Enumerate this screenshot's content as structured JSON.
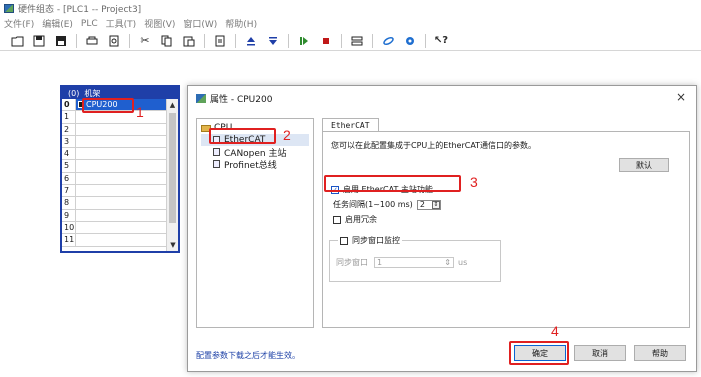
{
  "window": {
    "title": "硬件组态 - [PLC1 -- Project3]"
  },
  "menu": [
    "文件(F)",
    "编辑(E)",
    "PLC",
    "工具(T)",
    "视图(V)",
    "窗口(W)",
    "帮助(H)"
  ],
  "toolbar": {
    "icons": [
      "new-file-icon",
      "save-icon",
      "save-all-icon",
      "print-icon",
      "print-preview-icon",
      "cut-icon",
      "copy-icon",
      "paste-icon",
      "properties-icon",
      "upload-icon",
      "download-icon",
      "run-icon",
      "stop-icon",
      "diagnostics-icon",
      "link-icon",
      "network-icon",
      "help-icon"
    ]
  },
  "rack": {
    "header_slot": "(0)",
    "header_title": "机架",
    "rows": [
      {
        "slot": "0",
        "module": "CPU200"
      },
      {
        "slot": "1",
        "module": ""
      },
      {
        "slot": "2",
        "module": ""
      },
      {
        "slot": "3",
        "module": ""
      },
      {
        "slot": "4",
        "module": ""
      },
      {
        "slot": "5",
        "module": ""
      },
      {
        "slot": "6",
        "module": ""
      },
      {
        "slot": "7",
        "module": ""
      },
      {
        "slot": "8",
        "module": ""
      },
      {
        "slot": "9",
        "module": ""
      },
      {
        "slot": "10",
        "module": ""
      },
      {
        "slot": "11",
        "module": ""
      }
    ]
  },
  "dialog": {
    "title": "属性 - CPU200",
    "close": "×",
    "tree": {
      "root": "CPU",
      "children": [
        "EtherCAT",
        "CANopen 主站",
        "Profinet总线"
      ]
    },
    "tab_label": "EtherCAT",
    "description": "您可以在此配置集成于CPU上的EtherCAT通信口的参数。",
    "default_button": "默认",
    "enable_master_label": "启用 EtherCAT 主站功能",
    "enable_master_checked": true,
    "task_interval_label": "任务间隔(1~100 ms)",
    "task_interval_value": "2",
    "redundancy_label": "启用冗余",
    "redundancy_checked": false,
    "sync_group_label": "同步窗口监控",
    "sync_window_label": "同步窗口",
    "sync_window_value": "1",
    "sync_window_unit": "us",
    "footer_note": "配置参数下载之后才能生效。",
    "ok_button": "确定",
    "cancel_button": "取消",
    "help_button": "帮助"
  },
  "annotations": [
    "1",
    "2",
    "3",
    "4"
  ],
  "colors": {
    "annotation_red": "#e02020",
    "rack_blue": "#1f3fa8",
    "selected_blue": "#1f5fcf"
  }
}
